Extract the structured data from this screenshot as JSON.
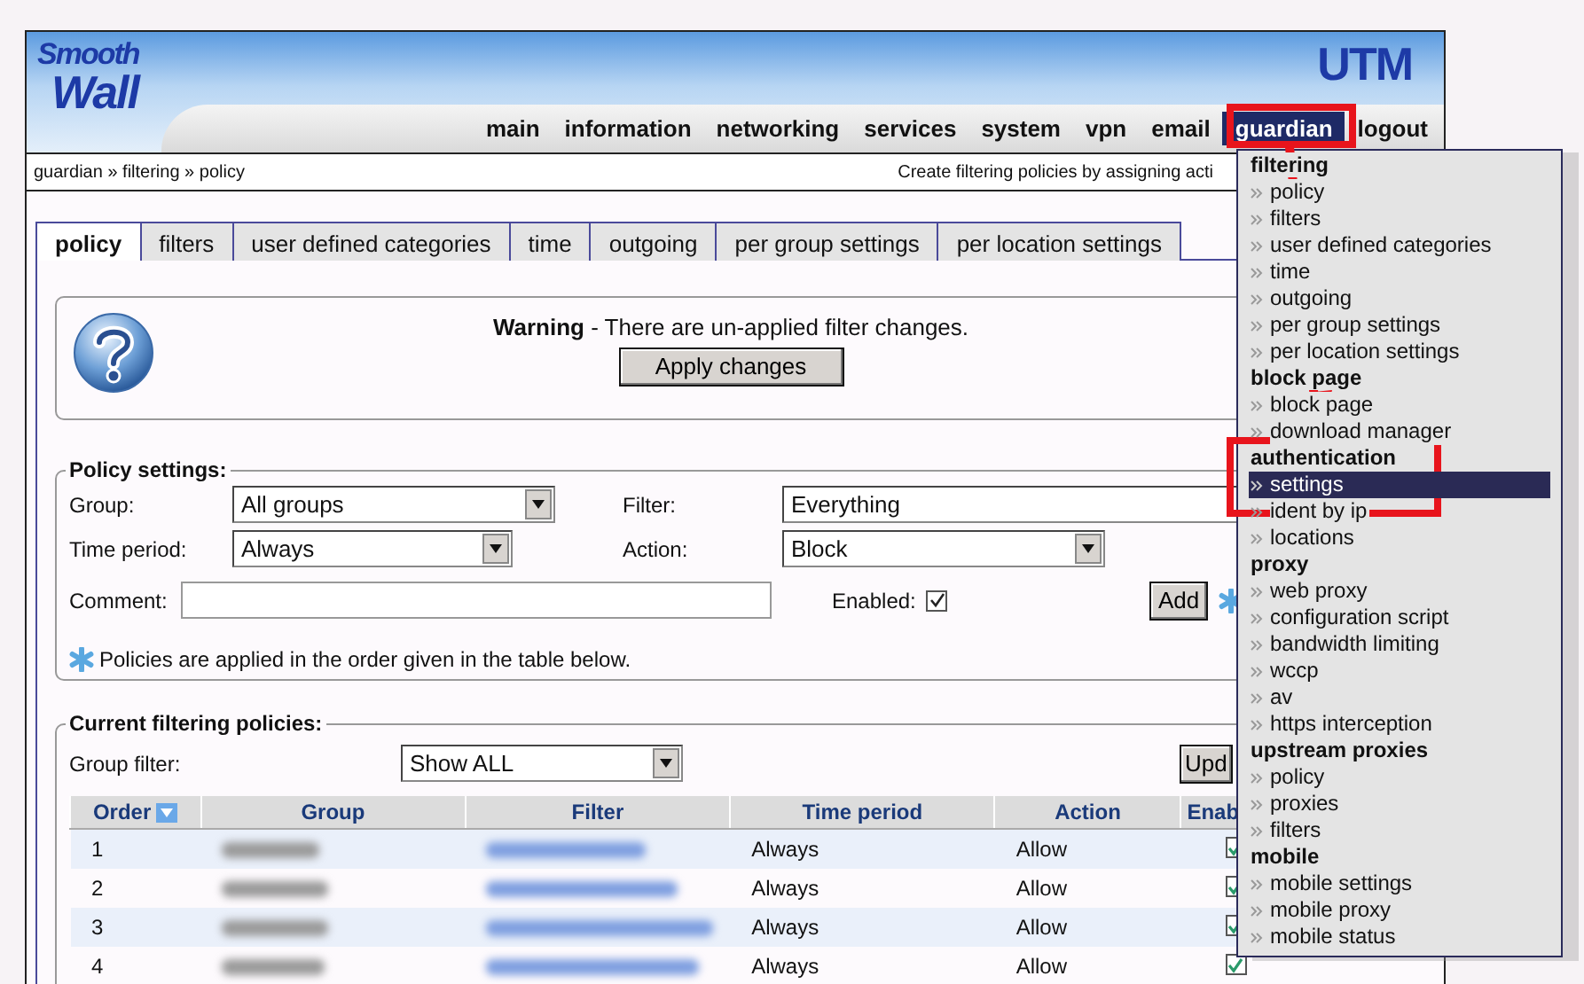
{
  "logo": {
    "lines": [
      "Smooth",
      "Wall"
    ],
    "product": "UTM"
  },
  "nav": [
    {
      "label": "main",
      "selected": false
    },
    {
      "label": "information",
      "selected": false
    },
    {
      "label": "networking",
      "selected": false
    },
    {
      "label": "services",
      "selected": false
    },
    {
      "label": "system",
      "selected": false
    },
    {
      "label": "vpn",
      "selected": false
    },
    {
      "label": "email",
      "selected": false
    },
    {
      "label": "guardian",
      "selected": true
    },
    {
      "label": "logout",
      "selected": false
    }
  ],
  "breadcrumb": "guardian » filtering » policy",
  "page_hint": "Create filtering policies by assigning acti",
  "tabs": [
    {
      "label": "policy",
      "selected": true
    },
    {
      "label": "filters",
      "selected": false
    },
    {
      "label": "user defined categories",
      "selected": false
    },
    {
      "label": "time",
      "selected": false
    },
    {
      "label": "outgoing",
      "selected": false
    },
    {
      "label": "per group settings",
      "selected": false
    },
    {
      "label": "per location settings",
      "selected": false
    }
  ],
  "warning": {
    "message": "**Warning** - There are un-applied filter changes.",
    "button": "Apply changes"
  },
  "policy_settings": {
    "legend": "Policy settings:",
    "group": {
      "label": "Group:",
      "value": "All groups"
    },
    "filter": {
      "label": "Filter:",
      "value": "Everything"
    },
    "time_period": {
      "label": "Time period:",
      "value": "Always"
    },
    "action": {
      "label": "Action:",
      "value": "Block"
    },
    "comment": {
      "label": "Comment:"
    },
    "enabled": {
      "label": "Enabled:",
      "checked": true
    },
    "add_button": "Add",
    "note": "Policies are applied in the order given in the table below."
  },
  "policies": {
    "legend": "Current filtering policies:",
    "group_filter": {
      "label": "Group filter:",
      "value": "Show ALL"
    },
    "update_button": "Upd",
    "columns": [
      "Order",
      "Group",
      "Filter",
      "Time period",
      "Action",
      "Enab"
    ],
    "rows": [
      {
        "order": "1",
        "time_period": "Always",
        "action": "Allow",
        "enabled": true
      },
      {
        "order": "2",
        "time_period": "Always",
        "action": "Allow",
        "enabled": true
      },
      {
        "order": "3",
        "time_period": "Always",
        "action": "Allow",
        "enabled": true
      },
      {
        "order": "4",
        "time_period": "Always",
        "action": "Allow",
        "enabled": true
      }
    ]
  },
  "menu": {
    "sections": [
      {
        "heading": "filtering",
        "items": [
          {
            "label": "policy",
            "selected": false
          },
          {
            "label": "filters",
            "selected": false
          },
          {
            "label": "user defined categories",
            "selected": false
          },
          {
            "label": "time",
            "selected": false
          },
          {
            "label": "outgoing",
            "selected": false
          },
          {
            "label": "per group settings",
            "selected": false
          },
          {
            "label": "per location settings",
            "selected": false
          }
        ]
      },
      {
        "heading": "block page",
        "items": [
          {
            "label": "block page",
            "selected": false
          },
          {
            "label": "download manager",
            "selected": false
          }
        ]
      },
      {
        "heading": "authentication",
        "items": [
          {
            "label": "settings",
            "selected": true
          },
          {
            "label": "ident by ip",
            "selected": false
          },
          {
            "label": "locations",
            "selected": false
          }
        ]
      },
      {
        "heading": "proxy",
        "items": [
          {
            "label": "web proxy",
            "selected": false
          },
          {
            "label": "configuration script",
            "selected": false
          },
          {
            "label": "bandwidth limiting",
            "selected": false
          },
          {
            "label": "wccp",
            "selected": false
          },
          {
            "label": "av",
            "selected": false
          },
          {
            "label": "https interception",
            "selected": false
          }
        ]
      },
      {
        "heading": "upstream proxies",
        "items": [
          {
            "label": "policy",
            "selected": false
          },
          {
            "label": "proxies",
            "selected": false
          },
          {
            "label": "filters",
            "selected": false
          }
        ]
      },
      {
        "heading": "mobile",
        "items": [
          {
            "label": "mobile settings",
            "selected": false
          },
          {
            "label": "mobile proxy",
            "selected": false
          },
          {
            "label": "mobile status",
            "selected": false
          }
        ]
      }
    ]
  }
}
